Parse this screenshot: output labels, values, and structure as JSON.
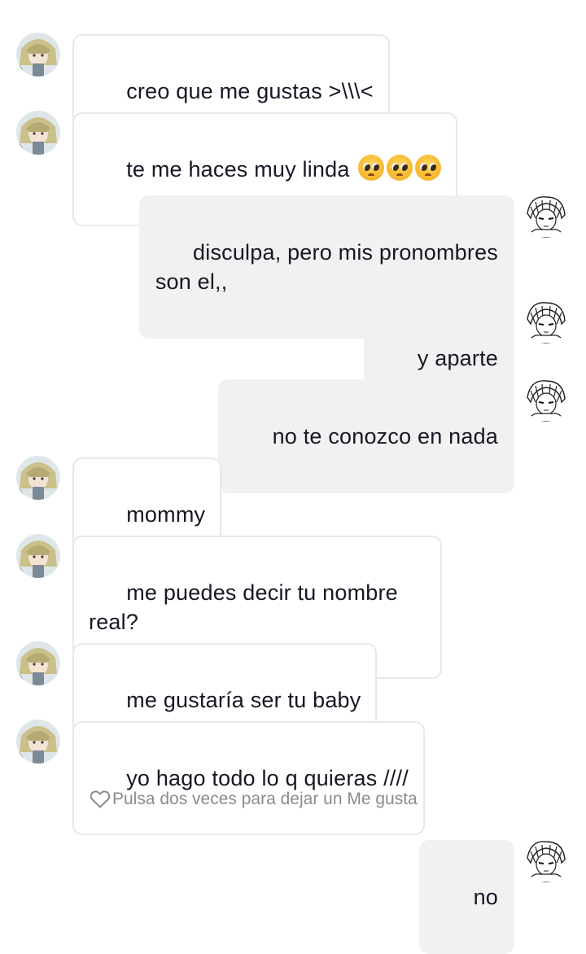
{
  "messages": [
    {
      "side": "them",
      "text": "creo que me gustas >\\\\\\<",
      "emoji_count": 0
    },
    {
      "side": "them",
      "text": "te me haces muy linda ",
      "emoji_count": 3,
      "emoji_icon": "pleading-face-emoji"
    },
    {
      "side": "me",
      "text": "disculpa, pero mis pronombres\nson el,,",
      "emoji_count": 0
    },
    {
      "side": "me",
      "text": "y aparte",
      "emoji_count": 0
    },
    {
      "side": "me",
      "text": "no te conozco en nada",
      "emoji_count": 0
    },
    {
      "side": "them",
      "text": "mommy",
      "emoji_count": 0
    },
    {
      "side": "them",
      "text": "me puedes decir tu nombre\nreal?",
      "emoji_count": 0
    },
    {
      "side": "them",
      "text": "me gustaría ser tu baby",
      "emoji_count": 0
    },
    {
      "side": "them",
      "text": "yo hago todo lo q quieras ////",
      "emoji_count": 0
    },
    {
      "side": "me",
      "text": "no",
      "emoji_count": 0
    }
  ],
  "like_hint": {
    "text": "Pulsa dos veces para dejar un Me gusta",
    "icon": "heart-outline-icon"
  },
  "avatars": {
    "them": "anime-character-avatar",
    "me": "manga-character-avatar"
  },
  "colors": {
    "incoming_bubble_bg": "#ffffff",
    "incoming_bubble_border": "#e8e8ea",
    "outgoing_bubble_bg": "#f1f1f2",
    "text": "#161823",
    "hint_text": "#8a8b91"
  }
}
